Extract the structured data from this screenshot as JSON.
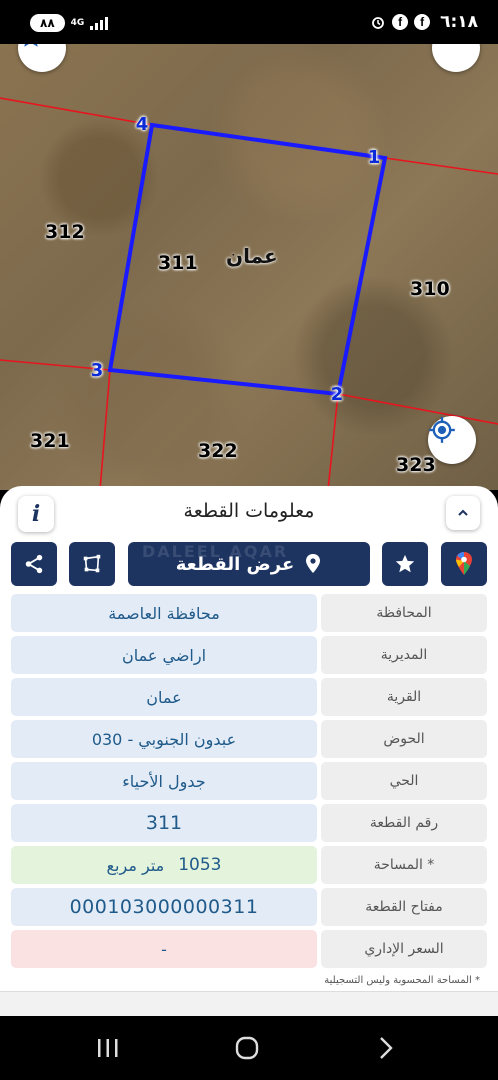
{
  "status_bar": {
    "time": "٦:١٨",
    "battery": "٨٨",
    "network": "4G",
    "icons": [
      "alarm-icon",
      "facebook-icon",
      "facebook-icon",
      "signal-icon"
    ]
  },
  "map": {
    "parcel_labels": [
      "312",
      "311",
      "310",
      "321",
      "322",
      "323"
    ],
    "area_name": "عمان",
    "vertices": [
      "1",
      "2",
      "3",
      "4"
    ],
    "colors": {
      "parcel_outline": "#1a1aff",
      "boundary_lines": "#e8141e",
      "vertex_text": "#0a2ad8"
    }
  },
  "sheet": {
    "title": "معلومات القطعة",
    "show_parcel_label": "عرض القطعة",
    "watermark": "DALEEL AQAR",
    "rows": [
      {
        "label": "المحافظة",
        "value": "محافظة العاصمة"
      },
      {
        "label": "المديرية",
        "value": "اراضي عمان"
      },
      {
        "label": "القرية",
        "value": "عمان"
      },
      {
        "label": "الحوض",
        "value": "عبدون الجنوبي - 030"
      },
      {
        "label": "الحي",
        "value": "جدول الأحياء"
      },
      {
        "label": "رقم القطعة",
        "value": "311"
      },
      {
        "label": "المساحة *",
        "value_number": "1053",
        "value_unit": "متر مربع"
      },
      {
        "label": "مفتاح القطعة",
        "value": "000103000000311"
      },
      {
        "label": "السعر الإداري",
        "value": "-"
      }
    ],
    "footnote": "* المساحة المحسوبة وليس التسجيلية",
    "colors": {
      "primary": "#1d3461",
      "value_bg": "#e3ecf6",
      "area_bg": "#e4f3dc",
      "price_bg": "#fbe2e2"
    }
  }
}
